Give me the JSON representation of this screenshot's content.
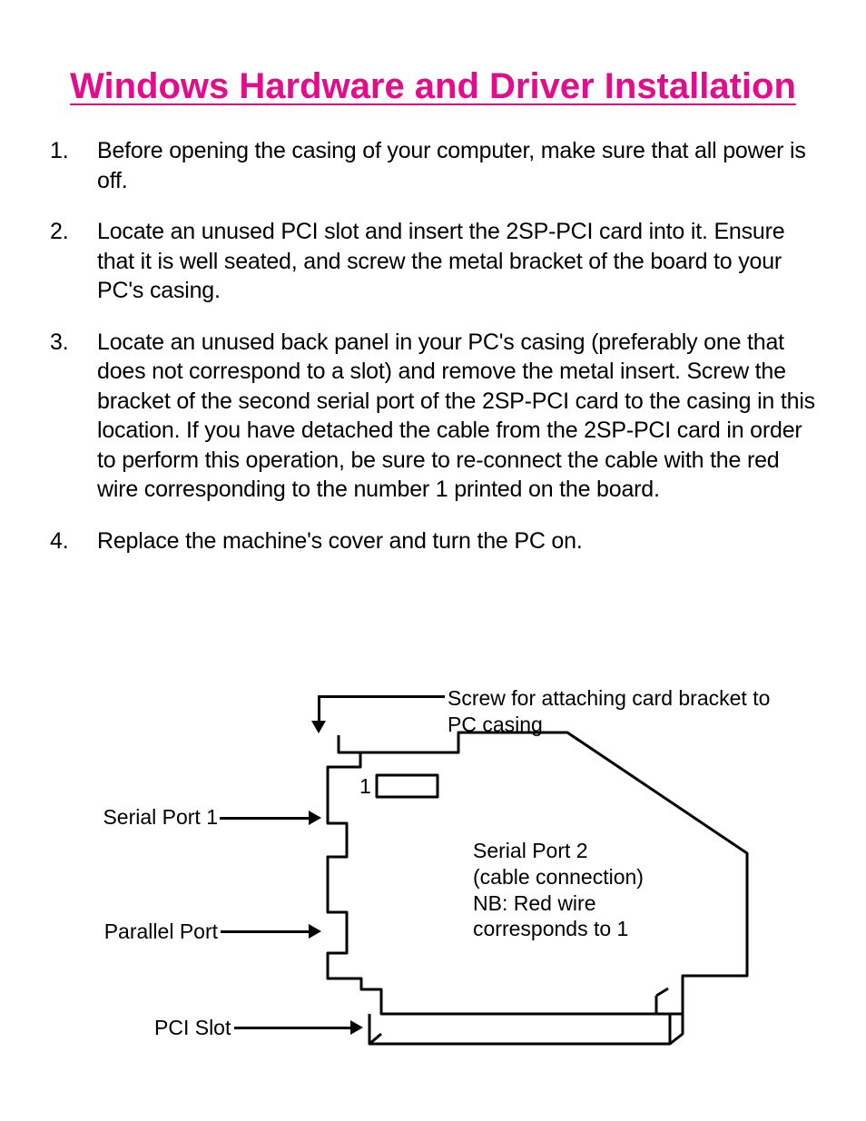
{
  "title": "Windows Hardware and Driver Installation",
  "steps": [
    {
      "n": "1.",
      "t": "Before opening the casing of your computer, make sure that all power is off."
    },
    {
      "n": "2.",
      "t": "Locate an unused PCI slot and insert the 2SP-PCI card into it. Ensure that it is well seated, and screw the metal bracket of the board to your PC's casing."
    },
    {
      "n": "3.",
      "t": "Locate an unused back panel in your PC's casing (preferably one that does not correspond to a slot) and remove the metal insert. Screw the bracket of the second serial port of the 2SP-PCI card to the casing in this location. If you have detached the cable from the 2SP-PCI card in order to perform this operation, be sure to re-connect the cable with the red wire corresponding to the number 1 printed on the board."
    },
    {
      "n": "4.",
      "t": "Replace the machine's cover and turn the PC on."
    }
  ],
  "diagram": {
    "pin1": "1",
    "screw_label": "Screw for attaching card bracket to PC casing",
    "serial1": "Serial Port 1",
    "parallel": "Parallel Port",
    "pci": "PCI Slot",
    "serial2": "Serial Port 2\n(cable connection)\nNB: Red wire\ncorresponds to 1"
  }
}
